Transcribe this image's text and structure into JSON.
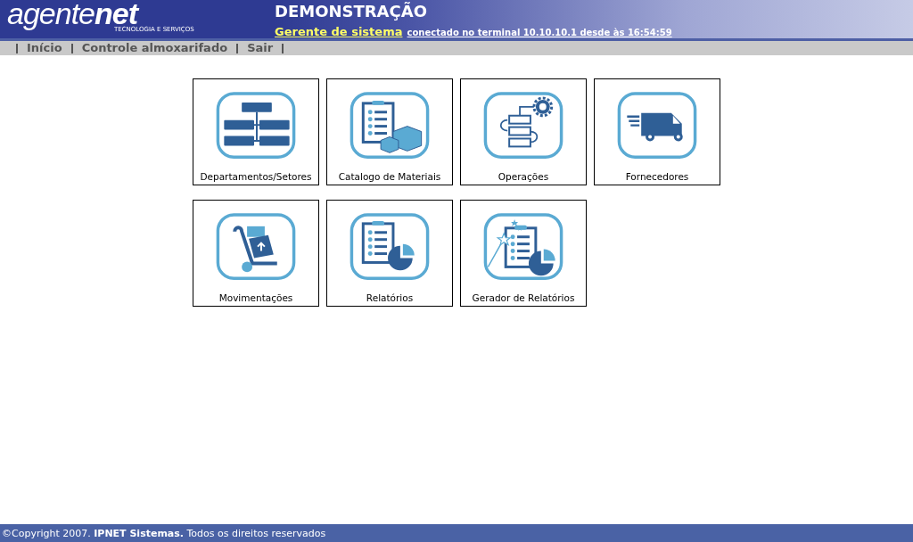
{
  "header": {
    "logo_main": "agente",
    "logo_accent": "net",
    "logo_tagline": "TECNOLOGIA E SERVIÇOS",
    "title": "DEMONSTRAÇÃO",
    "user": "Gerente de sistema",
    "session": "conectado no terminal 10.10.10.1 desde às 16:54:59"
  },
  "menu": [
    "Início",
    "Controle almoxarifado",
    "Sair"
  ],
  "tiles": [
    {
      "kind": "orgchart",
      "label": "Departamentos/Setores"
    },
    {
      "kind": "catalog",
      "label": "Catalogo de Materiais"
    },
    {
      "kind": "operations",
      "label": "Operações"
    },
    {
      "kind": "truck",
      "label": "Fornecedores"
    },
    {
      "kind": "handtruck",
      "label": "Movimentações"
    },
    {
      "kind": "report",
      "label": "Relatórios"
    },
    {
      "kind": "wizard",
      "label": "Gerador de Relatórios"
    }
  ],
  "footer": "©Copyright 2007. **IPNET Sistemas.** Todos os direitos reservados"
}
